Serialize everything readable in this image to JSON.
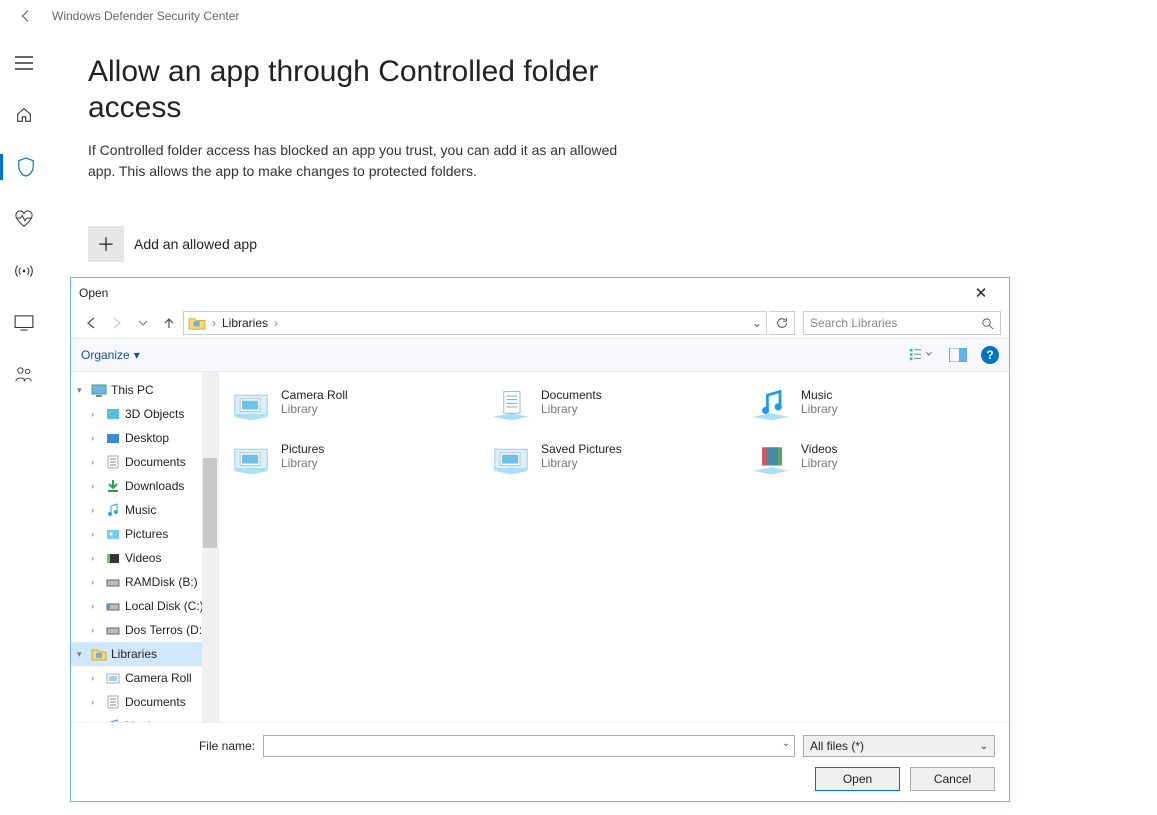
{
  "window_title": "Windows Defender Security Center",
  "page": {
    "title": "Allow an app through Controlled folder access",
    "description": "If Controlled folder access has blocked an app you trust, you can add it as an allowed app. This allows the app to make changes to protected folders.",
    "add_button": "Add an allowed app"
  },
  "dialog": {
    "title": "Open",
    "breadcrumb": [
      "Libraries"
    ],
    "search_placeholder": "Search Libraries",
    "organize_label": "Organize",
    "tree": {
      "root": "This PC",
      "root_children": [
        "3D Objects",
        "Desktop",
        "Documents",
        "Downloads",
        "Music",
        "Pictures",
        "Videos",
        "RAMDisk (B:)",
        "Local Disk (C:)",
        "Dos Terros (D:)"
      ],
      "libraries_label": "Libraries",
      "libraries_children": [
        "Camera Roll",
        "Documents",
        "Music"
      ]
    },
    "items": [
      {
        "name": "Camera Roll",
        "sub": "Library",
        "icon": "picture"
      },
      {
        "name": "Documents",
        "sub": "Library",
        "icon": "doc"
      },
      {
        "name": "Music",
        "sub": "Library",
        "icon": "music"
      },
      {
        "name": "Pictures",
        "sub": "Library",
        "icon": "picture"
      },
      {
        "name": "Saved Pictures",
        "sub": "Library",
        "icon": "picture"
      },
      {
        "name": "Videos",
        "sub": "Library",
        "icon": "video"
      }
    ],
    "filename_label": "File name:",
    "filter": "All files (*)",
    "open_btn": "Open",
    "cancel_btn": "Cancel"
  }
}
